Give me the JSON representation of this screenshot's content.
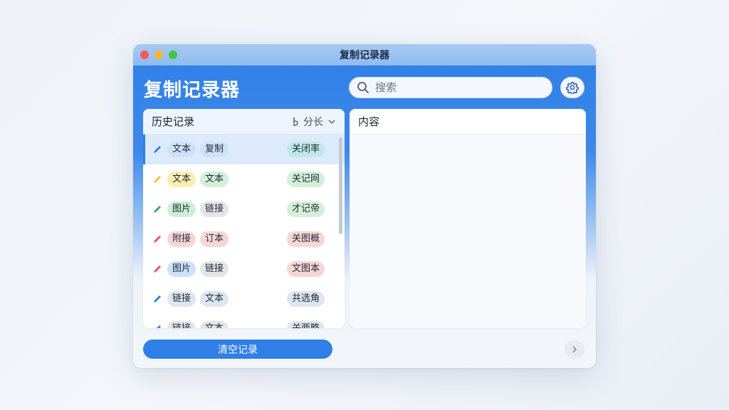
{
  "window": {
    "title": "复制记录器"
  },
  "app": {
    "title": "复制记录器"
  },
  "search": {
    "placeholder": "搜索"
  },
  "history": {
    "header": "历史记录",
    "sort_label": "分长",
    "items": [
      {
        "pencil_color": "#2f7fe6",
        "tag1": {
          "text": "文本",
          "color": "#cfe1fa"
        },
        "tag2": {
          "text": "复制",
          "color": "#cfe1fa"
        },
        "right": {
          "text": "关闭率",
          "color": "#bfe9e6"
        },
        "selected": true
      },
      {
        "pencil_color": "#f2c230",
        "tag1": {
          "text": "文本",
          "color": "#fbeeb0"
        },
        "tag2": {
          "text": "文本",
          "color": "#d4f0d8"
        },
        "right": {
          "text": "关记网",
          "color": "#d4f0d8"
        }
      },
      {
        "pencil_color": "#2fae59",
        "tag1": {
          "text": "图片",
          "color": "#ccefd6"
        },
        "tag2": {
          "text": "链接",
          "color": "#e3e5e8"
        },
        "right": {
          "text": "才记帝",
          "color": "#d4f0d8"
        }
      },
      {
        "pencil_color": "#e5545a",
        "tag1": {
          "text": "附接",
          "color": "#f8d6d6"
        },
        "tag2": {
          "text": "订本",
          "color": "#f8d6d6"
        },
        "right": {
          "text": "关图概",
          "color": "#f8d6d6"
        }
      },
      {
        "pencil_color": "#e5545a",
        "tag1": {
          "text": "图片",
          "color": "#cfe1fa"
        },
        "tag2": {
          "text": "链接",
          "color": "#e3e5e8"
        },
        "right": {
          "text": "文图本",
          "color": "#f8d6d6"
        }
      },
      {
        "pencil_color": "#2f7fe6",
        "tag1": {
          "text": "链接",
          "color": "#dde6f2"
        },
        "tag2": {
          "text": "文本",
          "color": "#dde6f2"
        },
        "right": {
          "text": "共选角",
          "color": "#dde6f2"
        }
      },
      {
        "pencil_color": "#2f7fe6",
        "tag1": {
          "text": "链接",
          "color": "#e3e5e8"
        },
        "tag2": {
          "text": "文本",
          "color": "#e3e5e8"
        },
        "right": {
          "text": "关两略",
          "color": "#e3e5e8"
        }
      }
    ]
  },
  "content": {
    "header": "内容"
  },
  "actions": {
    "clear": "清空记录"
  },
  "icons": {
    "search": "search-icon",
    "settings": "gear-icon",
    "sort": "sort-icon",
    "next": "chevron-right-icon"
  },
  "colors": {
    "accent": "#2f7fe6"
  }
}
